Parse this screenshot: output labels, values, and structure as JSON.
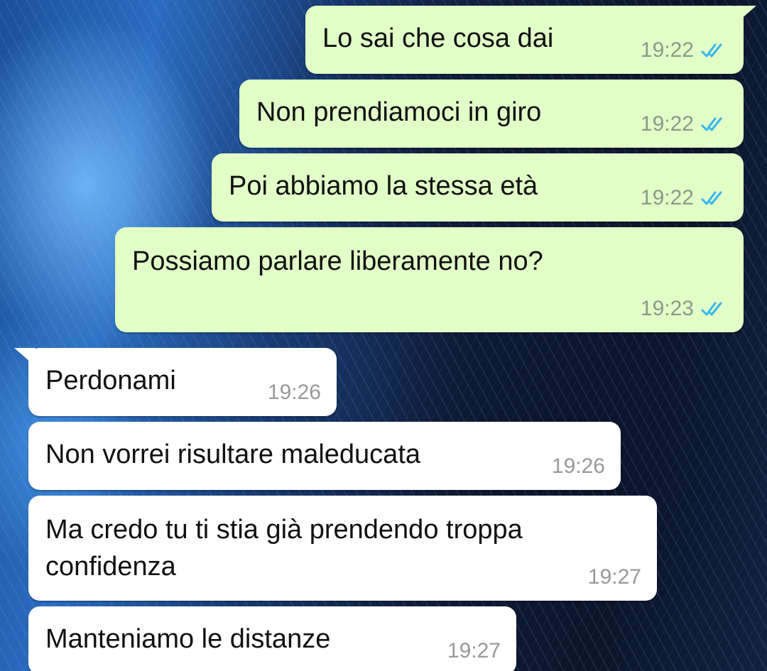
{
  "colors": {
    "outgoing_bubble": "#e2ffc7",
    "incoming_bubble": "#ffffff",
    "read_ticks": "#34b7f1"
  },
  "messages": [
    {
      "direction": "outgoing",
      "text": "Lo sai che cosa dai",
      "time": "19:22",
      "status_icon": "double-check-read-icon"
    },
    {
      "direction": "outgoing",
      "text": "Non prendiamoci in giro",
      "time": "19:22",
      "status_icon": "double-check-read-icon"
    },
    {
      "direction": "outgoing",
      "text": "Poi abbiamo la stessa età",
      "time": "19:22",
      "status_icon": "double-check-read-icon"
    },
    {
      "direction": "outgoing",
      "text": "Possiamo parlare liberamente no?",
      "time": "19:23",
      "status_icon": "double-check-read-icon"
    },
    {
      "direction": "incoming",
      "text": "Perdonami",
      "time": "19:26"
    },
    {
      "direction": "incoming",
      "text": "Non vorrei risultare maleducata",
      "time": "19:26"
    },
    {
      "direction": "incoming",
      "text": "Ma credo tu ti stia già prendendo troppa\nconfidenza",
      "time": "19:27"
    },
    {
      "direction": "incoming",
      "text": "Manteniamo le distanze",
      "time": "19:27"
    }
  ]
}
